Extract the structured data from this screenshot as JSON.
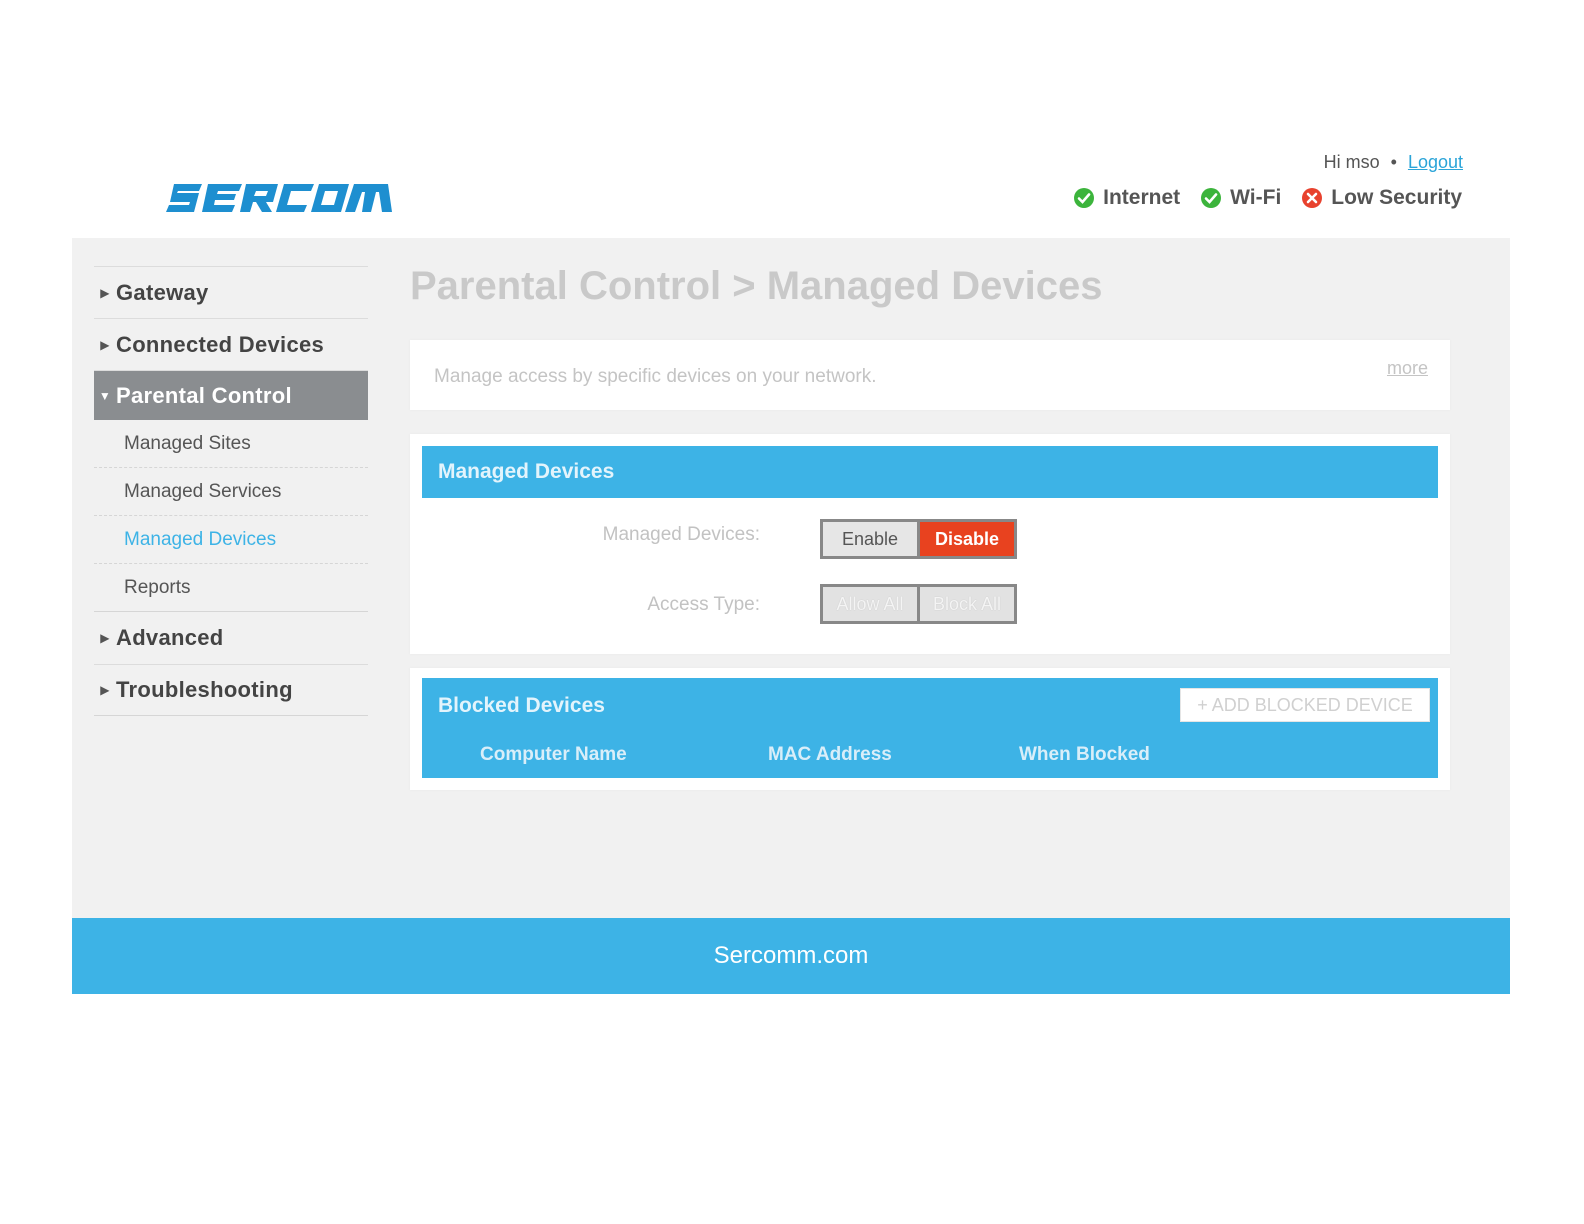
{
  "header": {
    "logo_text": "SERCOMM",
    "greeting": "Hi mso",
    "separator": "•",
    "logout_label": "Logout",
    "status": [
      {
        "label": "Internet",
        "state": "ok",
        "icon": "check-circle-icon",
        "color": "#3cb43c"
      },
      {
        "label": "Wi-Fi",
        "state": "ok",
        "icon": "check-circle-icon",
        "color": "#3cb43c"
      },
      {
        "label": "Low Security",
        "state": "error",
        "icon": "x-circle-icon",
        "color": "#e8422e"
      }
    ]
  },
  "sidebar": {
    "items": [
      {
        "label": "Gateway",
        "expanded": false
      },
      {
        "label": "Connected Devices",
        "expanded": false
      },
      {
        "label": "Parental Control",
        "expanded": true,
        "subitems": [
          "Managed Sites",
          "Managed Services",
          "Managed Devices",
          "Reports"
        ],
        "current": "Managed Devices"
      },
      {
        "label": "Advanced",
        "expanded": false
      },
      {
        "label": "Troubleshooting",
        "expanded": false
      }
    ]
  },
  "content": {
    "title": "Parental Control > Managed Devices",
    "description": "Manage access by specific devices on your network.",
    "more_label": "more",
    "managed_devices": {
      "section_title": "Managed Devices",
      "managed_label": "Managed Devices:",
      "enable_label": "Enable",
      "disable_label": "Disable",
      "selected": "Disable",
      "access_type_label": "Access Type:",
      "allow_all_label": "Allow All",
      "block_all_label": "Block All"
    },
    "blocked_devices": {
      "section_title": "Blocked Devices",
      "add_button_label": "+ ADD BLOCKED DEVICE",
      "columns": [
        "Computer Name",
        "MAC Address",
        "When Blocked"
      ]
    }
  },
  "footer": {
    "text": "Sercomm.com"
  },
  "colors": {
    "accent": "#3db3e6",
    "logo": "#1e8fd0",
    "danger": "#e8421f",
    "sidebar_active": "#8a8d90"
  }
}
